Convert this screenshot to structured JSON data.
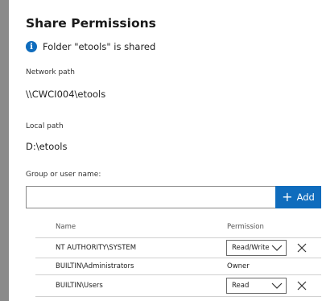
{
  "dialog": {
    "title": "Share Permissions",
    "info_text": "Folder \"etools\" is shared",
    "network_path_label": "Network path",
    "network_path_value": "\\\\CWCI004\\etools",
    "local_path_label": "Local path",
    "local_path_value": "D:\\etools",
    "group_label": "Group or user name:",
    "search": {
      "value": "",
      "placeholder": ""
    },
    "add_label": "Add"
  },
  "table": {
    "headers": {
      "name": "Name",
      "permission": "Permission"
    },
    "rows": [
      {
        "name": "NT AUTHORITY\\SYSTEM",
        "permission": "Read/Write",
        "editable": true
      },
      {
        "name": "BUILTIN\\Administrators",
        "permission": "Owner",
        "editable": false
      },
      {
        "name": "BUILTIN\\Users",
        "permission": "Read",
        "editable": true
      }
    ]
  },
  "colors": {
    "accent": "#0f6cbd",
    "left_strip": "#8a8a8a"
  },
  "icons": {
    "info": "info-icon",
    "add": "plus-icon",
    "remove": "close-icon",
    "dropdown": "chevron-down-icon"
  }
}
